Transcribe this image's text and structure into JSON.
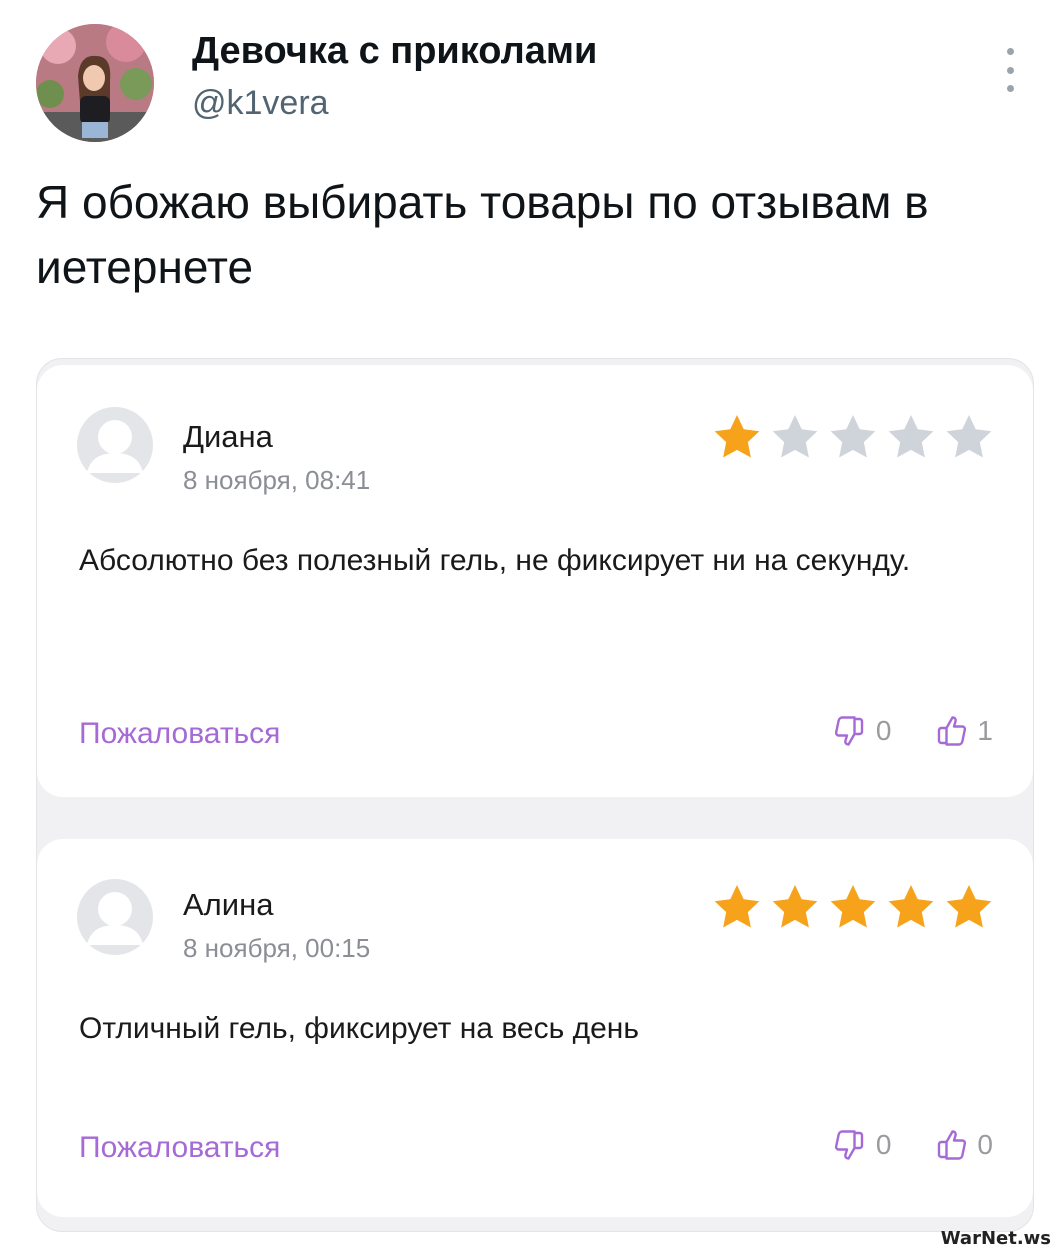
{
  "tweet": {
    "display_name": "Девочка с приколами",
    "handle": "@k1vera",
    "text": "Я обожаю выбирать товары по отзывам в иетернете"
  },
  "reviews": [
    {
      "author": "Диана",
      "date": "8 ноября, 08:41",
      "rating": 1,
      "max_rating": 5,
      "text": "Абсолютно без полезный гель, не фиксирует ни на секунду.",
      "complain_label": "Пожаловаться",
      "dislikes": "0",
      "likes": "1"
    },
    {
      "author": "Алина",
      "date": "8 ноября, 00:15",
      "rating": 5,
      "max_rating": 5,
      "text": "Отличный гель, фиксирует на весь день",
      "complain_label": "Пожаловаться",
      "dislikes": "0",
      "likes": "0"
    }
  ],
  "watermark": "WarNet.ws",
  "colors": {
    "star_filled": "#f7a21b",
    "star_empty": "#cfd3da",
    "complain_link": "#a56ad6",
    "vote_icon": "#a56ad6"
  },
  "icons": {
    "more": "vertical-dots-icon",
    "dislike": "thumbs-down-icon",
    "like": "thumbs-up-icon",
    "review_avatar": "user-placeholder-icon",
    "rating": "star-icon"
  }
}
